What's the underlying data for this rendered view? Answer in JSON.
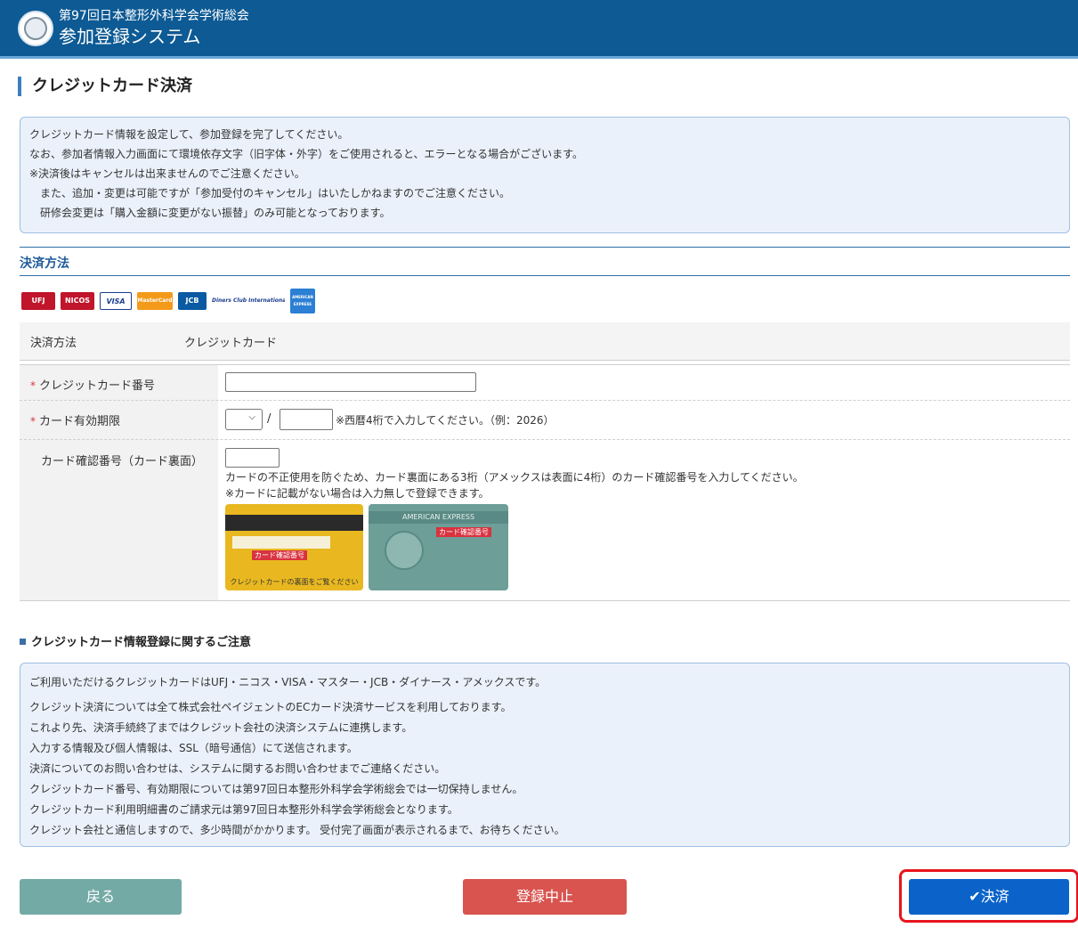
{
  "header": {
    "subtitle": "第97回日本整形外科学会学術総会",
    "title": "参加登録システム"
  },
  "page": {
    "title": "クレジットカード決済"
  },
  "info": [
    "クレジットカード情報を設定して、参加登録を完了してください。",
    "なお、参加者情報入力画面にて環境依存文字（旧字体・外字）をご使用されると、エラーとなる場合がございます。",
    "※決済後はキャンセルは出来ませんのでご注意ください。",
    "また、追加・変更は可能ですが「参加受付のキャンセル」はいたしかねますのでご注意ください。",
    "研修会変更は「購入金額に変更がない振替」のみ可能となっております。"
  ],
  "section": {
    "title": "決済方法"
  },
  "card_logos": [
    "UFJ",
    "NICOS",
    "VISA",
    "MasterCard",
    "JCB",
    "Diners Club International",
    "AMERICAN EXPRESS"
  ],
  "form": {
    "method_label": "決済方法",
    "method_value": "クレジットカード",
    "required_mark": "*",
    "card_number_label": "クレジットカード番号",
    "card_number_value": "",
    "expiry_label": "カード有効期限",
    "expiry_month_value": "",
    "expiry_separator": "/",
    "expiry_year_value": "",
    "expiry_hint": "※西暦4桁で入力してください。（例：2026）",
    "cvv_label": "カード確認番号（カード裏面）",
    "cvv_value": "",
    "cvv_hint1": "カードの不正使用を防ぐため、カード裏面にある3桁（アメックスは表面に4桁）のカード確認番号を入力してください。",
    "cvv_hint2": "※カードに記載がない場合は入力無しで登録できます。",
    "card_image1_caption": "クレジットカードの裏面をご覧ください",
    "card_image1_tag": "カード確認番号",
    "card_image2_brand": "AMERICAN EXPRESS",
    "card_image2_tag": "カード確認番号"
  },
  "notice": {
    "title": "クレジットカード情報登録に関するご注意",
    "lines": [
      "ご利用いただけるクレジットカードはUFJ・ニコス・VISA・マスター・JCB・ダイナース・アメックスです。",
      "クレジット決済については全て株式会社ペイジェントのECカード決済サービスを利用しております。",
      "これより先、決済手続終了まではクレジット会社の決済システムに連携します。",
      "入力する情報及び個人情報は、SSL（暗号通信）にて送信されます。",
      "決済についてのお問い合わせは、システムに関するお問い合わせまでご連絡ください。",
      "クレジットカード番号、有効期限については第97回日本整形外科学会学術総会では一切保持しません。",
      "クレジットカード利用明細書のご請求元は第97回日本整形外科学会学術総会となります。",
      "クレジット会社と通信しますので、多少時間がかかります。 受付完了画面が表示されるまで、お待ちください。"
    ]
  },
  "buttons": {
    "back": "戻る",
    "cancel": "登録中止",
    "pay": "✔決済"
  },
  "colors": {
    "header_bg": "#0d5a94",
    "accent_blue": "#0b63c9",
    "cancel_red": "#d9534f",
    "back_teal": "#74aaa6",
    "highlight_red": "#e8141c"
  }
}
